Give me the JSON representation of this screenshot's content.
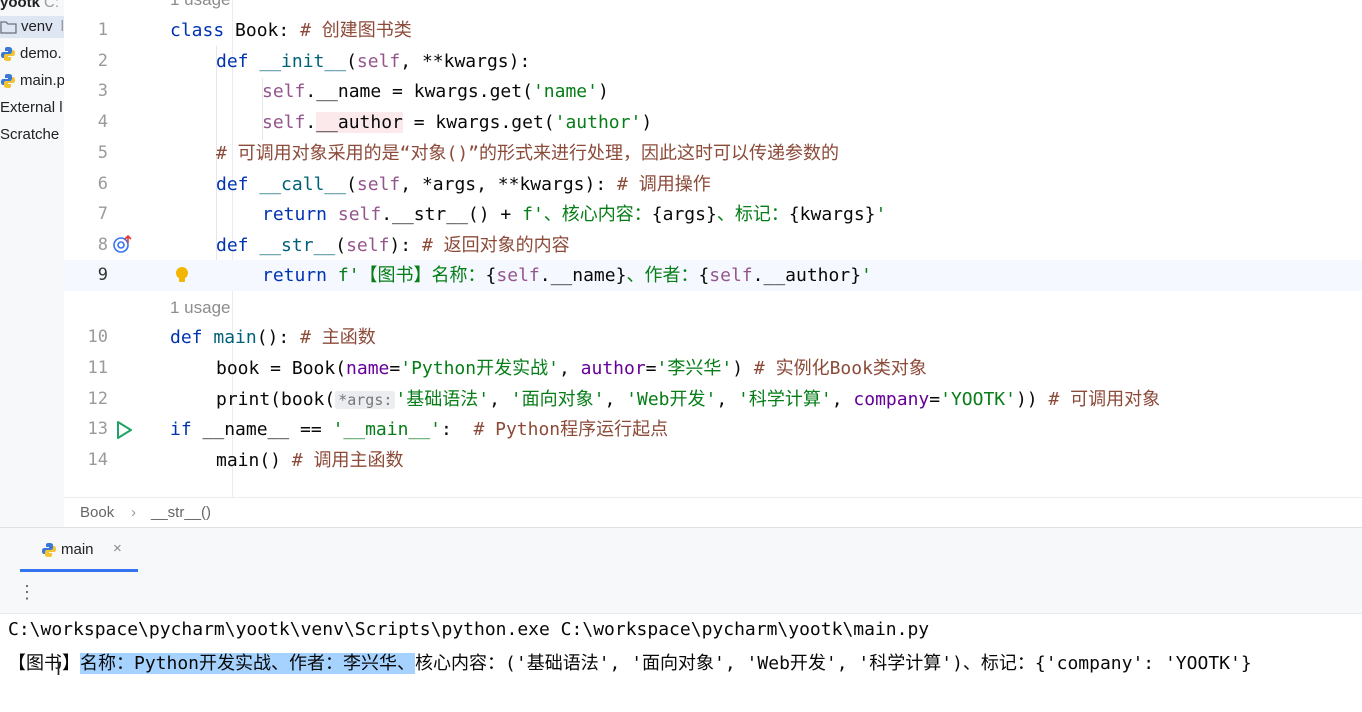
{
  "project": {
    "root_label": "yootk",
    "root_path": "C:",
    "items": [
      {
        "label": "venv",
        "note": "l",
        "icon": "folder-icon"
      },
      {
        "label": "demo.",
        "icon": "python-file-icon"
      },
      {
        "label": "main.p",
        "icon": "python-file-icon"
      },
      {
        "label": "External l"
      },
      {
        "label": "Scratche"
      }
    ]
  },
  "editor": {
    "line_numbers": [
      "1",
      "2",
      "3",
      "4",
      "5",
      "6",
      "7",
      "8",
      "9",
      "10",
      "11",
      "12",
      "13",
      "14"
    ],
    "usage_hint_top": "1 usage",
    "usage_hint": "1 usage",
    "code": {
      "l1": {
        "kw": "class ",
        "name": "Book",
        "punc": ": ",
        "cmt": "# 创建图书类"
      },
      "l2": {
        "kw": "def ",
        "fn": "__init__",
        "open": "(",
        "self": "self",
        "rest": ", **kwargs):"
      },
      "l3": {
        "self": "self",
        "mid": ".__name = kwargs.get(",
        "str": "'name'",
        "end": ")"
      },
      "l4": {
        "self": "self",
        "dot": ".",
        "attr": "__author",
        "mid": " = kwargs.get(",
        "str": "'author'",
        "end": ")"
      },
      "l5": {
        "cmt": "# 可调用对象采用的是“对象()”的形式来进行处理，因此这时可以传递参数的"
      },
      "l6": {
        "kw": "def ",
        "fn": "__call__",
        "open": "(",
        "self": "self",
        "rest": ", *args, **kwargs): ",
        "cmt": "# 调用操作"
      },
      "l7": {
        "kw": "return ",
        "self": "self",
        "mid": ".__str__() + ",
        "s1": "f'、核心内容：",
        "e1": "{args}",
        "s2": "、标记：",
        "e2": "{kwargs}",
        "s3": "'"
      },
      "l8": {
        "kw": "def ",
        "fn": "__str__",
        "open": "(",
        "self": "self",
        "rest": "): ",
        "cmt": "# 返回对象的内容"
      },
      "l9": {
        "kw": "return ",
        "s1": "f'【图书】名称：",
        "b1": "{",
        "self1": "self",
        "e1": ".__name",
        "b2": "}",
        "s2": "、作者：",
        "b3": "{",
        "self2": "self",
        "e2": ".__author",
        "b4": "}",
        "s3": "'"
      },
      "l10": {
        "kw": "def ",
        "fn": "main",
        "rest": "(): ",
        "cmt": "# 主函数"
      },
      "l11": {
        "pre": "book = Book(",
        "p1": "name",
        "eq1": "=",
        "s1": "'Python开发实战'",
        "sep": ", ",
        "p2": "author",
        "eq2": "=",
        "s2": "'李兴华'",
        "end": ") ",
        "cmt": "# 实例化Book类对象"
      },
      "l12": {
        "pre": "print(book(",
        "hint": "*args:",
        "s1": "'基础语法'",
        "c1": ", ",
        "s2": "'面向对象'",
        "c2": ", ",
        "s3": "'Web开发'",
        "c3": ", ",
        "s4": "'科学计算'",
        "c4": ", ",
        "p": "company",
        "eq": "=",
        "s5": "'YOOTK'",
        "end": ")) ",
        "cmt": "# 可调用对象"
      },
      "l13": {
        "kw": "if ",
        "mid": "__name__ == ",
        "str": "'__main__'",
        "sp": ":  ",
        "cmt": "# Python程序运行起点"
      },
      "l14": {
        "pre": "main() ",
        "cmt": "# 调用主函数"
      }
    }
  },
  "breadcrumb": {
    "items": [
      "Book",
      "__str__()"
    ],
    "separator": "›"
  },
  "run_panel": {
    "tab_label": "main",
    "tab_close": "×",
    "kebab": "⋮",
    "command": "C:\\workspace\\pycharm\\yootk\\venv\\Scripts\\python.exe C:\\workspace\\pycharm\\yootk\\main.py",
    "output_pre": "【图书】",
    "output_selected": "名称：Python开发实战、作者：李兴华、",
    "output_post": "核心内容：('基础语法', '面向对象', 'Web开发', '科学计算')、标记：{'company': 'YOOTK'}",
    "cursor_glyph": "I"
  },
  "colors": {
    "keyword": "#0033b3",
    "function": "#00627a",
    "self": "#94558d",
    "string": "#067d17",
    "comment": "#8c8c8c",
    "accent": "#3574f0",
    "selection": "#a6d2ff"
  }
}
